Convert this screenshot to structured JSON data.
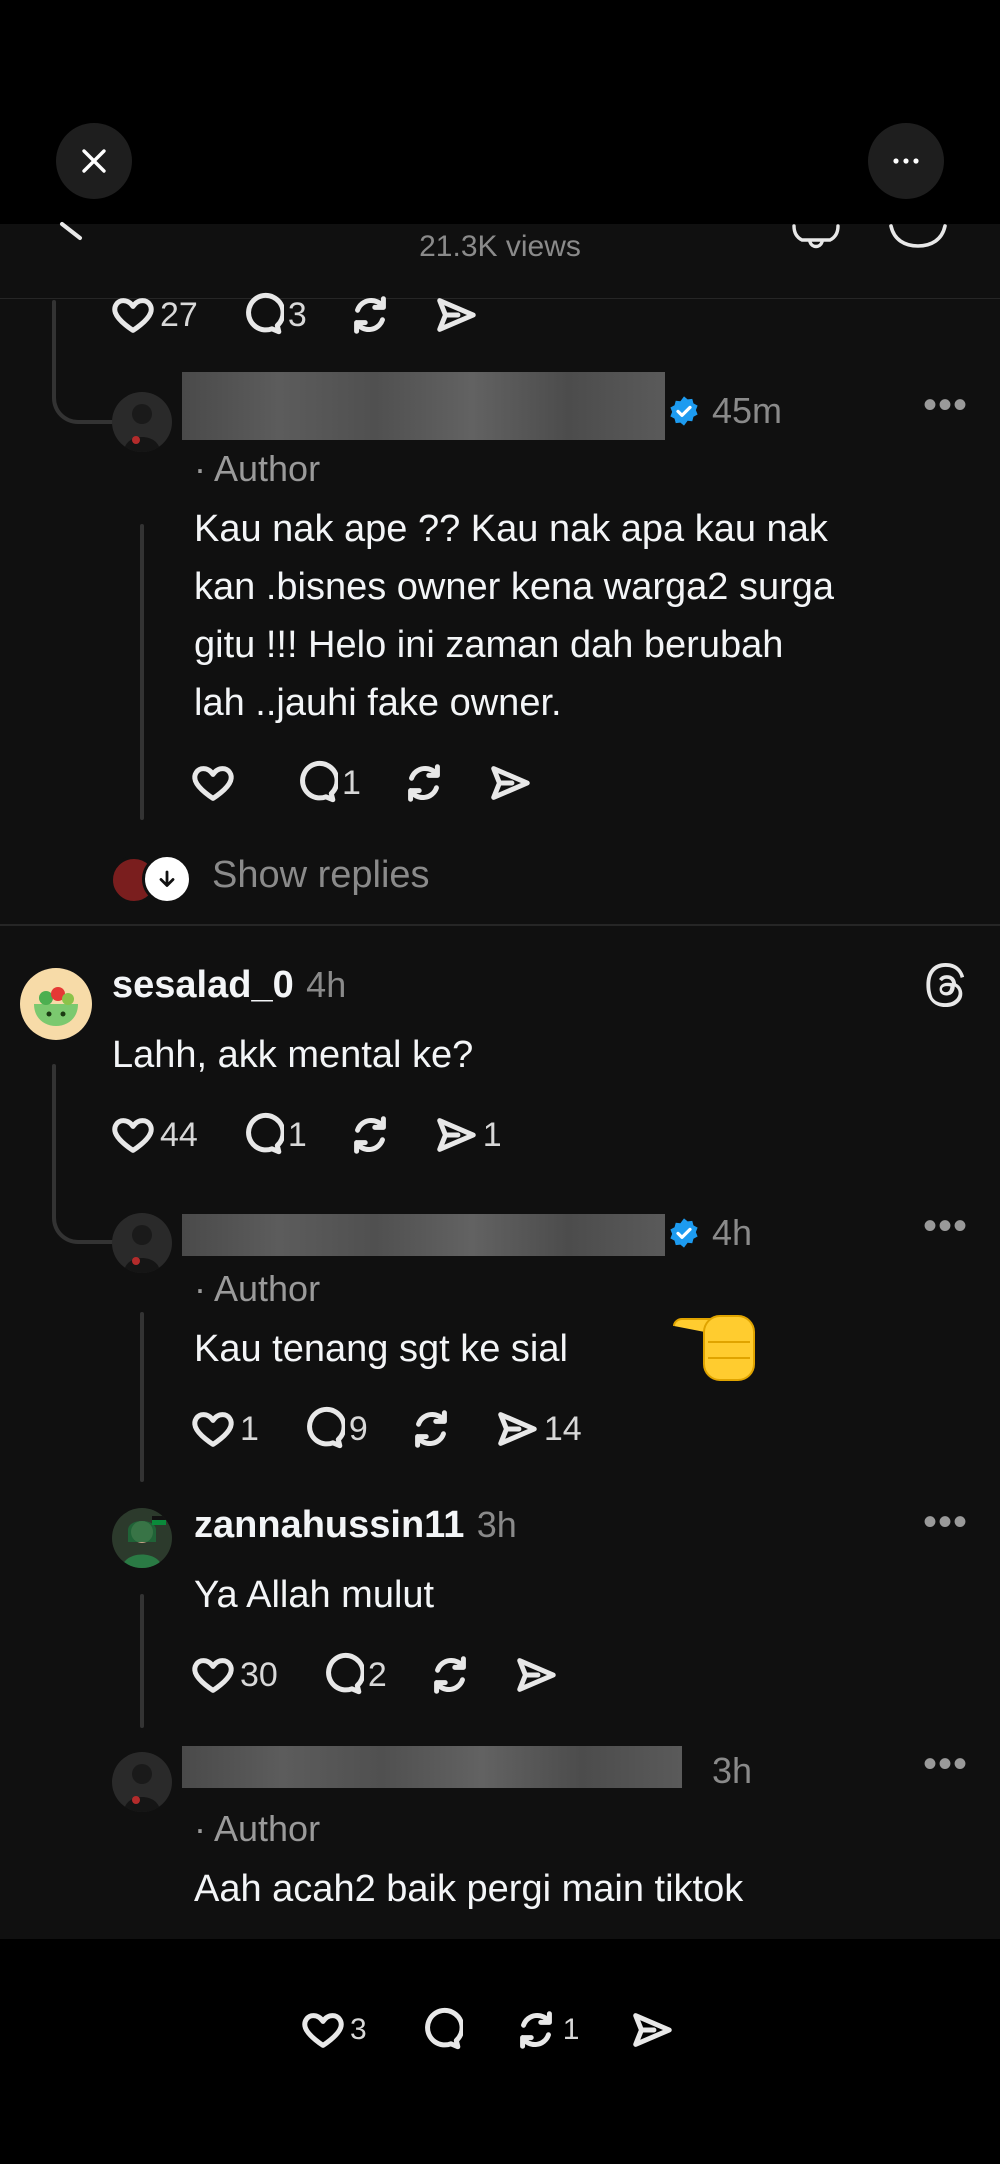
{
  "header": {
    "views": "21.3K views"
  },
  "top_actions": {
    "likes": "27",
    "replies": "3"
  },
  "comments": [
    {
      "time": "45m",
      "author_tag": "· Author",
      "text_lines": [
        "Kau nak ape ?? Kau nak apa kau nak",
        "kan .bisnes owner kena warga2 surga",
        "gitu !!! Helo ini zaman dah berubah",
        "lah ..jauhi fake owner."
      ],
      "replies": "1",
      "show_replies": "Show replies"
    },
    {
      "username": "sesalad_0",
      "time": "4h",
      "text": "Lahh, akk mental ke?",
      "likes": "44",
      "replies": "1",
      "shares": "1"
    },
    {
      "time": "4h",
      "author_tag": "· Author",
      "text": "Kau tenang sgt ke sial",
      "likes": "1",
      "replies": "9",
      "shares": "14"
    },
    {
      "username": "zannahussin11",
      "time": "3h",
      "text": "Ya Allah mulut",
      "likes": "30",
      "replies": "2"
    },
    {
      "time": "3h",
      "author_tag": "· Author",
      "text": "Aah acah2 baik pergi main tiktok"
    }
  ],
  "bottom_bar": {
    "likes": "3",
    "reposts": "1"
  },
  "colors": {
    "background": "#101010",
    "verified": "#1d9bf0",
    "muted": "#8a8a8a"
  }
}
